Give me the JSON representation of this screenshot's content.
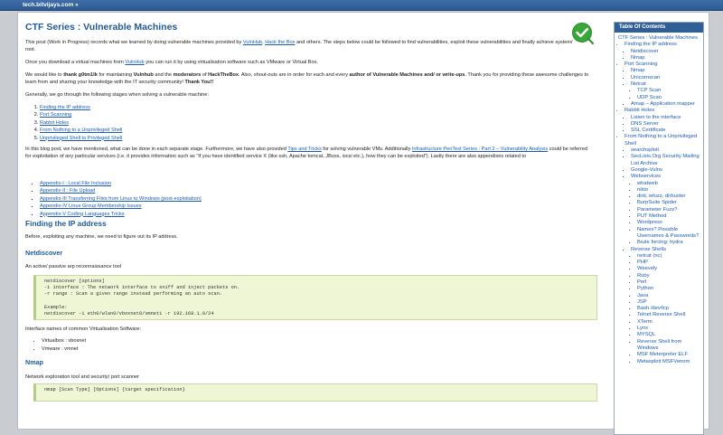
{
  "topbar": {
    "breadcrumb": "tech.bitvijays.com  »"
  },
  "article": {
    "title": "CTF Series : Vulnerable Machines",
    "intro": {
      "before": "This post (Work in Progress) records what we learned by doing vulnerable machines provided by ",
      "link1": "VulnHub",
      "mid1": ", ",
      "link2": "Hack the Box",
      "after": " and others. The steps below could be followed to find vulnerabilities, exploit these vulnerabilities and finally achieve system/ root."
    },
    "download": {
      "before": "Once you download a virtual machines from ",
      "link": "VulnHub",
      "after": " you can run it by using virtualisation software such as VMware or Virtual Box."
    },
    "thanks": {
      "t1": "We would like to ",
      "b1": "thank g0tm1lk",
      "t2": " for maintaining ",
      "b2": "Vulnhub",
      "t3": " and the ",
      "b3": "moderators",
      "t4": " of ",
      "b4": "HackTheBox",
      "t5": ". Also, shout-outs are in order for each and every ",
      "b5": "author of Vulnerable Machines and/ or write-ups",
      "t6": ". Thank you for providing these awesome challenges to learn from and sharing your knowledge with the IT security community! ",
      "b6": "Thank You!!"
    },
    "generally": "Generally, we go through the following stages when solving a vulnerable machine:",
    "stages": [
      "Finding the IP address",
      "Port Scanning",
      "Rabbit Holes",
      "From Nothing to a Unprivileged Shell",
      "Unprivileged Shell to Privileged Shell"
    ],
    "blogpost": {
      "t1": "In this blog post, we have mentioned, what can be done in each separate stage. Furthermore, we have also provided ",
      "l1": "Tips and Tricks",
      "t2": " for solving vulnerable VMs. Additionally ",
      "l2": "Infrastructure PenTest Series : Part 2 – Vulnerability Analysis",
      "t3": " could be referred for exploitation of any particular services (i.e. it provides information such as “If you have identified service X (like ssh, Apache tomcat, JBoss, iscsi etc.), how they can be exploited”). Lastly there are also appendixes related to"
    },
    "appendixes": [
      "Appendix-I : Local File Inclusion",
      "Appendix-II : File Upload",
      "Appendix-III Transferring Files from Linux to Windows (post-exploitation)",
      "Appendix-IV Linux Group Membership Issues",
      "Appendix-V Coding Languages Tricks"
    ],
    "section_ip": "Finding the IP address",
    "ip_intro": "Before, exploiting any machine, we need to figure out its IP address.",
    "netdiscover_heading": "Netdiscover",
    "netdiscover_desc": "An active/ passive arp reconnaissance tool",
    "netdiscover_code": "netdiscover [options]\n-i interface : The network interface to sniff and inject packets on.\n-r range : Scan a given range instead performing an auto scan.\n\nExample:\nnetdiscover -i eth0/wlan0/vboxnet0/vmnet1 -r 192.168.1.0/24",
    "interface_names": "Interface names of common Virtualisation Software:",
    "virt": [
      "Virtualbox : vboxnet",
      "Vmware : vmnet"
    ],
    "nmap_heading": "Nmap",
    "nmap_desc": "Network exploration tool and security/ port scanner",
    "nmap_code": "nmap [Scan Type] [Options] {target specification}"
  },
  "toc": {
    "title": "Table Of Contents",
    "items": [
      {
        "label": "CTF Series : Vulnerable Machines",
        "level": 0
      },
      {
        "label": "Finding the IP address",
        "level": 1
      },
      {
        "label": "Netdiscover",
        "level": 2
      },
      {
        "label": "Nmap",
        "level": 2
      },
      {
        "label": "Port Scanning",
        "level": 1
      },
      {
        "label": "Nmap",
        "level": 2
      },
      {
        "label": "Unicornscan",
        "level": 2
      },
      {
        "label": "Netcat",
        "level": 2
      },
      {
        "label": "TCP Scan",
        "level": 3
      },
      {
        "label": "UDP Scan",
        "level": 3
      },
      {
        "label": "Amap – Application mapper",
        "level": 2
      },
      {
        "label": "Rabbit Holes",
        "level": 1
      },
      {
        "label": "Listen to the interface",
        "level": 2
      },
      {
        "label": "DNS Server",
        "level": 2
      },
      {
        "label": "SSL Certificate",
        "level": 2
      },
      {
        "label": "From Nothing to a Unprivileged Shell",
        "level": 1
      },
      {
        "label": "searchsploit",
        "level": 2
      },
      {
        "label": "SecLists.Org Security Mailing List Archive",
        "level": 2
      },
      {
        "label": "Google-Vulns",
        "level": 2
      },
      {
        "label": "Webservices",
        "level": 2
      },
      {
        "label": "whatweb",
        "level": 3
      },
      {
        "label": "nikto",
        "level": 3
      },
      {
        "label": "dirb, wfuzz, dirbuster",
        "level": 3
      },
      {
        "label": "BurpSuite Spider",
        "level": 3
      },
      {
        "label": "Parameter Fuzz?",
        "level": 3
      },
      {
        "label": "PUT Method",
        "level": 3
      },
      {
        "label": "Wordpress",
        "level": 3
      },
      {
        "label": "Names? Possible Usernames & Passwords?",
        "level": 3
      },
      {
        "label": "Brute forcing: hydra",
        "level": 3
      },
      {
        "label": "Reverse Shells",
        "level": 2
      },
      {
        "label": "netcat (nc)",
        "level": 3
      },
      {
        "label": "PHP",
        "level": 3
      },
      {
        "label": "Weevely",
        "level": 3
      },
      {
        "label": "Ruby",
        "level": 3
      },
      {
        "label": "Perl",
        "level": 3
      },
      {
        "label": "Python",
        "level": 3
      },
      {
        "label": "Java",
        "level": 3
      },
      {
        "label": "JSP",
        "level": 3
      },
      {
        "label": "Bash /dev/tcp",
        "level": 3
      },
      {
        "label": "Telnet Reverse Shell",
        "level": 3
      },
      {
        "label": "XTerm",
        "level": 3
      },
      {
        "label": "Lynx",
        "level": 3
      },
      {
        "label": "MYSQL",
        "level": 3
      },
      {
        "label": "Reverse Shell from Windows",
        "level": 3
      },
      {
        "label": "MSF Meterpreter ELF",
        "level": 3
      },
      {
        "label": "Metasploit MSFVenom",
        "level": 3
      }
    ]
  },
  "colors": {
    "heading": "#1f5a99",
    "link": "#1a5bb5",
    "code_bg": "#eef6d6",
    "toc_header": "#2f5f94",
    "check_badge": "#3aa63a"
  }
}
